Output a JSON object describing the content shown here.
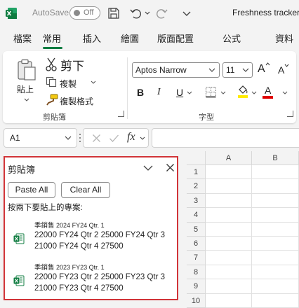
{
  "titlebar": {
    "autosave_label": "AutoSave",
    "autosave_state": "Off",
    "document_title": "Freshness tracker"
  },
  "tabs": [
    "檔案",
    "常用",
    "插入",
    "繪圖",
    "版面配置",
    "公式",
    "資料"
  ],
  "active_tab": "常用",
  "ribbon": {
    "paste_label": "貼上",
    "cut_label": "剪下",
    "copy_label": "複製",
    "format_painter_label": "複製格式",
    "clipboard_group": "剪貼簿",
    "font_name": "Aptos Narrow",
    "font_size": "11",
    "font_group": "字型",
    "grow_font": "A",
    "shrink_font": "A",
    "bold": "B",
    "italic": "I",
    "underline": "U",
    "font_color_letter": "A",
    "accent_color": "#107c41",
    "font_color_bar": "#e00000",
    "highlight_color_bar": "#ffeb00"
  },
  "formula_bar": {
    "name_box": "A1",
    "fx_label": "fx"
  },
  "clipboard_pane": {
    "title": "剪貼簿",
    "paste_all": "Paste All",
    "clear_all": "Clear All",
    "instruction": "按兩下要貼上的專案:",
    "items": [
      {
        "title_main": "季銷售",
        "title_year": "2024",
        "title_rest": "FY24 Qtr. 1",
        "body": "22000 FY24 Qtr 2 25000 FY24 Qtr 3 21000 FY24 Qtr 4 27500"
      },
      {
        "title_main": "季銷售",
        "title_year": "2023",
        "title_rest": "FY23 Qtr. 1",
        "body": "22000 FY23 Qtr 2 25000 FY23 Qtr 3 21000 FY23 Qtr 4 27500"
      }
    ]
  },
  "grid": {
    "columns": [
      "A",
      "B"
    ],
    "rows": [
      "1",
      "2",
      "3",
      "4",
      "5",
      "6",
      "7",
      "8",
      "9",
      "10"
    ]
  }
}
